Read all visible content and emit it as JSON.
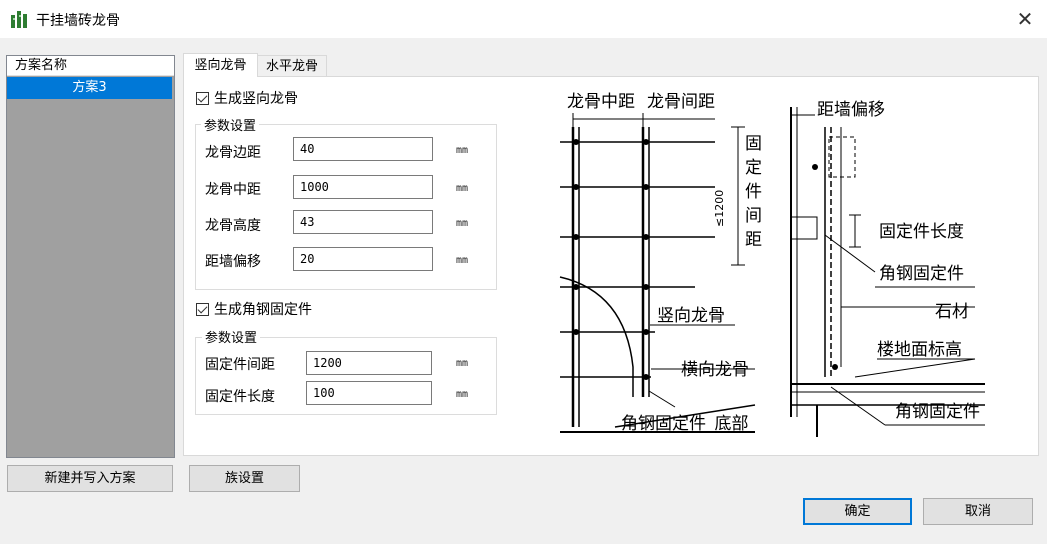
{
  "window": {
    "title": "干挂墙砖龙骨",
    "close_glyph": "✕"
  },
  "scheme_list": {
    "header": "方案名称",
    "items": [
      "方案3"
    ]
  },
  "tabs": [
    {
      "label": "竖向龙骨"
    },
    {
      "label": "水平龙骨"
    }
  ],
  "vertical_keel": {
    "generate_label": "生成竖向龙骨",
    "params_title": "参数设置",
    "fields": [
      {
        "label": "龙骨边距",
        "value": "40",
        "unit": "mm"
      },
      {
        "label": "龙骨中距",
        "value": "1000",
        "unit": "mm"
      },
      {
        "label": "龙骨高度",
        "value": "43",
        "unit": "mm"
      },
      {
        "label": "距墙偏移",
        "value": "20",
        "unit": "mm"
      }
    ]
  },
  "angle_fixture": {
    "generate_label": "生成角钢固定件",
    "params_title": "参数设置",
    "fields": [
      {
        "label": "固定件间距",
        "value": "1200",
        "unit": "mm"
      },
      {
        "label": "固定件长度",
        "value": "100",
        "unit": "mm"
      }
    ]
  },
  "diagram": {
    "label_center_spacing": "龙骨中距",
    "label_spacing": "龙骨间距",
    "label_fixture_spacing_v": "固\n定\n件\n间\n距",
    "label_le1200": "≤1200",
    "label_vertical_keel": "竖向龙骨",
    "label_horizontal_keel": "横向龙骨",
    "label_bottom_fixture": "角钢固定件_底部",
    "label_wall_offset": "距墙偏移",
    "label_fixture_length": "固定件长度",
    "label_angle_fixture": "角钢固定件",
    "label_stone": "石材",
    "label_floor_level": "楼地面标高",
    "label_angle_fixture_2": "角钢固定件"
  },
  "buttons": {
    "new_write": "新建并写入方案",
    "family_settings": "族设置",
    "ok": "确定",
    "cancel": "取消"
  },
  "colors": {
    "selection": "#0078d7",
    "list_bg": "#a0a0a0",
    "app_icon": "#2e7d32"
  }
}
